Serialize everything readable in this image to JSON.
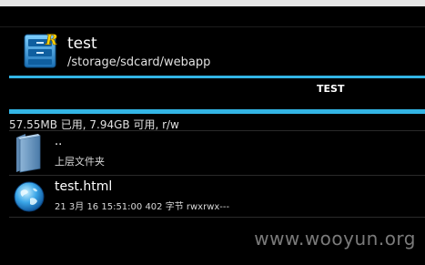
{
  "header": {
    "title": "test",
    "path": "/storage/sdcard/webapp",
    "icon": "file-cabinet-icon"
  },
  "tabs": [
    {
      "label": "TEST",
      "active": true
    }
  ],
  "storage": {
    "info": "57.55MB 已用, 7.94GB 可用, r/w"
  },
  "list": {
    "items": [
      {
        "name": "..",
        "sub": "上层文件夹",
        "icon": "folder-icon"
      },
      {
        "name": "test.html",
        "sub": "21 3月 16 15:51:00  402 字节  rwxrwx---",
        "icon": "globe-icon"
      }
    ]
  },
  "watermark": "www.wooyun.org",
  "colors": {
    "accent": "#33b5e5",
    "background": "#000000"
  }
}
